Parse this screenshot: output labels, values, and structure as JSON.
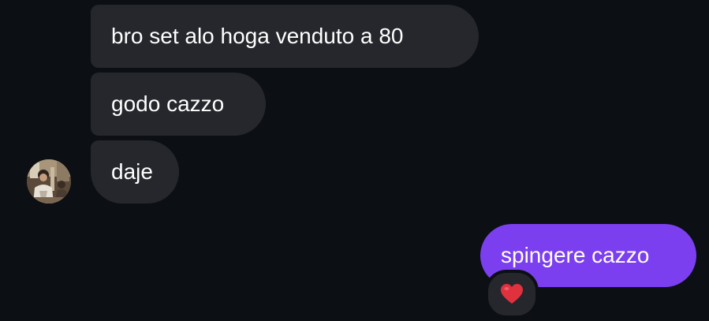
{
  "conversation": {
    "incoming_messages": [
      {
        "text": "bro set alo hoga venduto a 80"
      },
      {
        "text": "godo cazzo"
      },
      {
        "text": "daje"
      }
    ],
    "outgoing_messages": [
      {
        "text": "spingere cazzo",
        "reaction": "❤️"
      }
    ],
    "sender_avatar_icon": "user-avatar-photo",
    "reaction_icon": "red-heart-icon"
  },
  "colors": {
    "background": "#0c0f14",
    "incoming_bubble": "#25272c",
    "outgoing_bubble": "#7b3ff0",
    "text": "#ffffff",
    "heart": "#e0313f"
  }
}
